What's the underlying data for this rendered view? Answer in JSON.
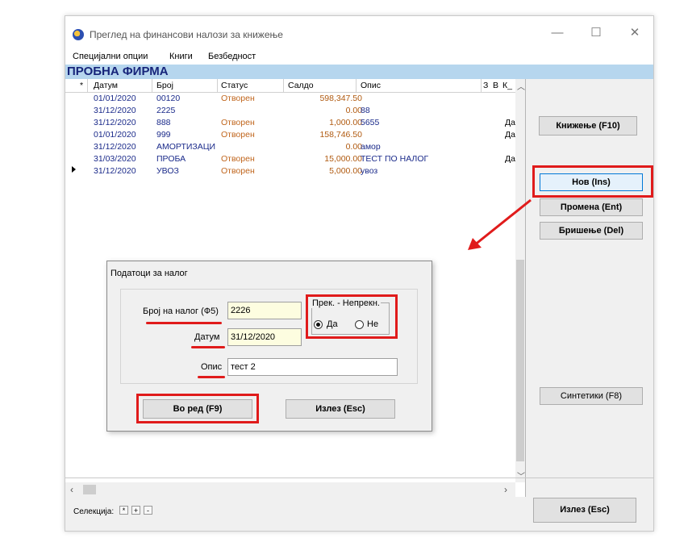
{
  "window": {
    "title": "Преглед на финансови налози за книжење"
  },
  "menu": [
    "Специјални опции",
    "Книги",
    "Безбедност"
  ],
  "company": "ПРОБНА ФИРМА",
  "grid": {
    "headers": [
      "*",
      "Датум",
      "Број",
      "Статус",
      "Салдо",
      "Опис",
      "З",
      "В",
      "К_"
    ],
    "rows": [
      {
        "date": "01/01/2020",
        "num": " 00120",
        "status": "Отворен",
        "saldo": "598,347.50",
        "opis": "",
        "k": ""
      },
      {
        "date": "31/12/2020",
        "num": "2225",
        "status": "",
        "saldo": "0.00",
        "opis": "88",
        "k": ""
      },
      {
        "date": "31/12/2020",
        "num": "888",
        "status": "Отворен",
        "saldo": "1,000.00",
        "opis": "5655",
        "k": "Да"
      },
      {
        "date": "01/01/2020",
        "num": "999",
        "status": "Отворен",
        "saldo": "158,746.50",
        "opis": "",
        "k": "Да"
      },
      {
        "date": "31/12/2020",
        "num": "АМОРТИЗАЦИ",
        "status": "",
        "saldo": "0.00",
        "opis": "амор",
        "k": ""
      },
      {
        "date": "31/03/2020",
        "num": "ПРОБА",
        "status": "Отворен",
        "saldo": "15,000.00",
        "opis": "ТЕСТ ПО НАЛОГ",
        "k": "Да"
      },
      {
        "date": "31/12/2020",
        "num": "УВОЗ",
        "status": "Отворен",
        "saldo": "5,000.00",
        "opis": "увоз",
        "k": ""
      }
    ]
  },
  "buttons": {
    "book": "Книжење (F10)",
    "new": "Нов (Ins)",
    "edit": "Промена (Ent)",
    "delete": "Бришење (Del)",
    "synth": "Синтетики (F8)",
    "exit": "Излез (Esc)"
  },
  "selection": {
    "label": "Селекција:",
    "b1": "*",
    "b2": "+",
    "b3": "-"
  },
  "dialog": {
    "title": "Податоци за налог",
    "num_label": "Број на налог (Ф5)",
    "num_value": "2226",
    "date_label": "Датум",
    "date_value": "31/12/2020",
    "desc_label": "Опис",
    "desc_value": "тест 2",
    "group_label": "Прек. - Непрекн.",
    "yes": "Да",
    "no": "Не",
    "ok": "Во ред (F9)",
    "cancel": "Излез (Esc)"
  },
  "colors": {
    "accent_red": "#e01b1b",
    "company_bar": "#b6d6ee"
  }
}
